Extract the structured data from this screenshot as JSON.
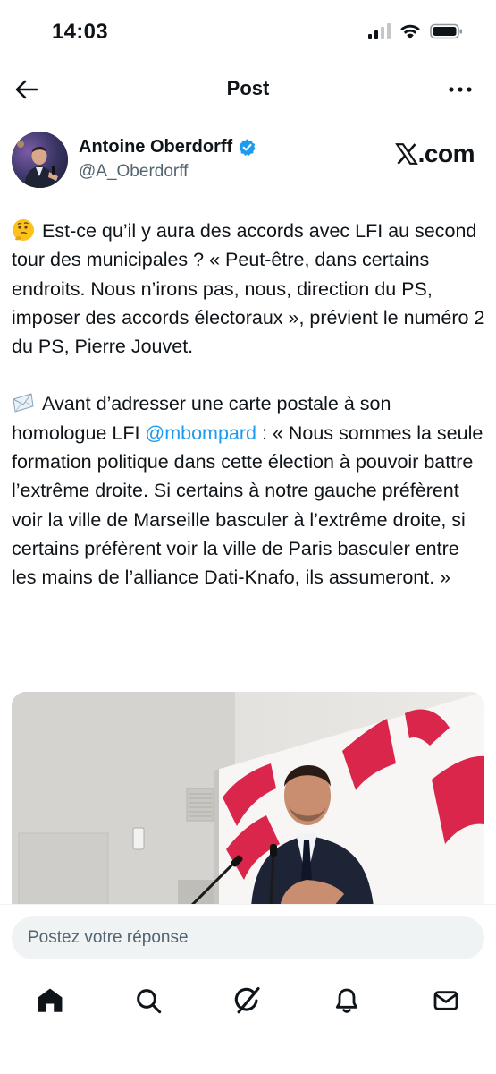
{
  "status_bar": {
    "time": "14:03"
  },
  "header": {
    "title": "Post",
    "back_icon": "arrow-left-icon",
    "more_icon": "more-horizontal-icon"
  },
  "author": {
    "name": "Antoine Oberdorff",
    "handle": "@A_Oberdorff",
    "verified": true,
    "verified_color": "#1d9bf0",
    "source_label": ".com"
  },
  "tweet": {
    "paragraph1": "Est-ce qu’il y aura des accords avec LFI au second tour des municipales ? « Peut-être, dans certains endroits. Nous n’irons pas, nous, direction du PS, imposer des accords électoraux », prévient le numéro 2 du PS, Pierre Jouvet.",
    "paragraph1_emoji": "thinking-face",
    "paragraph2_before": "Avant d’adresser une carte postale à son homologue LFI ",
    "paragraph2_mention": "@mbompard",
    "paragraph2_after": " : « Nous sommes la seule formation politique dans cette élection à pouvoir battre l’extrême droite. Si certains à notre gauche préfèrent voir la ville de Marseille basculer à l’extrême droite, si certains préfèrent voir la ville de Paris basculer entre les mains de l’alliance Dati-Knafo, ils assumeront. »",
    "paragraph2_emoji": "envelope",
    "mention_color": "#1d9bf0"
  },
  "reply": {
    "placeholder": "Postez votre réponse"
  },
  "nav": {
    "items": [
      "home-icon",
      "search-icon",
      "grok-icon",
      "notifications-icon",
      "messages-icon"
    ]
  },
  "colors": {
    "text": "#0f1419",
    "secondary": "#536471",
    "accent": "#1d9bf0",
    "ps_red": "#d9264a"
  }
}
